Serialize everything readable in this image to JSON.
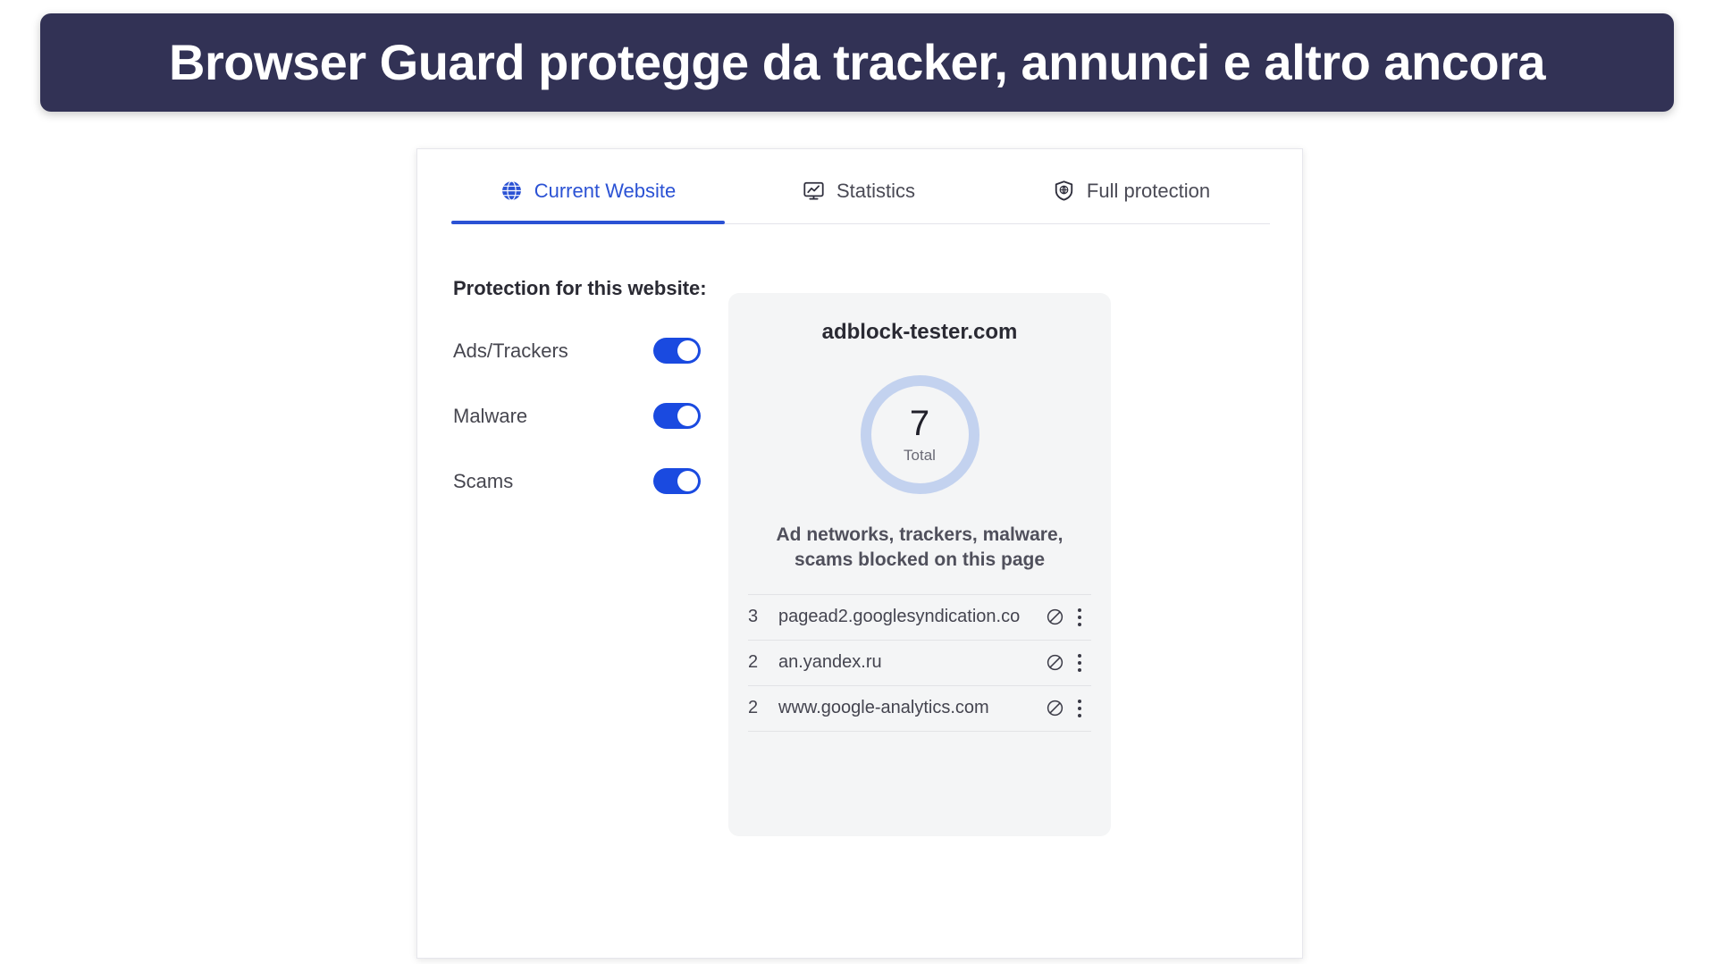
{
  "banner": {
    "text": "Browser Guard protegge da tracker, annunci e altro ancora",
    "background_color": "#323255",
    "text_color": "#ffffff"
  },
  "popup": {
    "accent_color": "#2b52d4",
    "toggle_on_color": "#1a4ae0",
    "tabs": [
      {
        "label": "Current Website",
        "icon": "globe-icon",
        "active": true
      },
      {
        "label": "Statistics",
        "icon": "chart-monitor-icon",
        "active": false
      },
      {
        "label": "Full protection",
        "icon": "shield-icon",
        "active": false
      }
    ],
    "protection": {
      "heading": "Protection for this website:",
      "items": [
        {
          "label": "Ads/Trackers",
          "state": "on"
        },
        {
          "label": "Malware",
          "state": "on"
        },
        {
          "label": "Scams",
          "state": "on"
        }
      ]
    },
    "site_card": {
      "domain": "adblock-tester.com",
      "counter": {
        "value": "7",
        "caption": "Total",
        "ring_color": "#c3d2ef"
      },
      "blocked_caption": "Ad networks, trackers, malware, scams blocked on this page",
      "blocked_items": [
        {
          "count": "3",
          "domain": "pagead2.googlesyndication.co",
          "block_icon": "block-circle-icon",
          "menu_icon": "more-vertical-icon"
        },
        {
          "count": "2",
          "domain": "an.yandex.ru",
          "block_icon": "block-circle-icon",
          "menu_icon": "more-vertical-icon"
        },
        {
          "count": "2",
          "domain": "www.google-analytics.com",
          "block_icon": "block-circle-icon",
          "menu_icon": "more-vertical-icon"
        }
      ]
    }
  }
}
